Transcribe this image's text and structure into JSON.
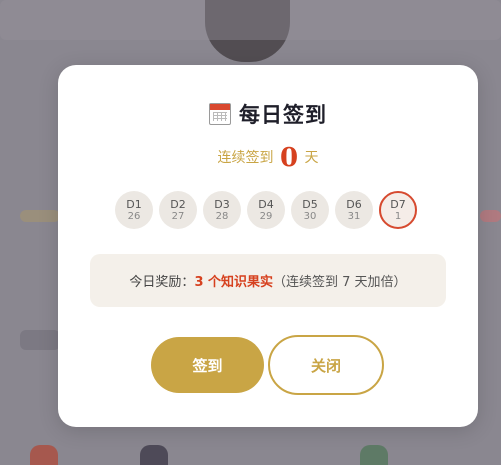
{
  "modal": {
    "title": "每日签到",
    "streak_prefix": "连续签到",
    "streak_count": "0",
    "streak_suffix": "天",
    "days": [
      {
        "label": "D1",
        "date": "26"
      },
      {
        "label": "D2",
        "date": "27"
      },
      {
        "label": "D3",
        "date": "28"
      },
      {
        "label": "D4",
        "date": "29"
      },
      {
        "label": "D5",
        "date": "30"
      },
      {
        "label": "D6",
        "date": "31"
      },
      {
        "label": "D7",
        "date": "1"
      }
    ],
    "reward_prefix": "今日奖励：",
    "reward_amount": "3 个知识果实",
    "reward_note": "（连续签到 7 天加倍）",
    "sign_button": "签到",
    "close_button": "关闭"
  },
  "colors": {
    "accent_gold": "#c9a545",
    "highlight_red": "#d6411f",
    "backdrop": "#8a8790"
  },
  "icons": {
    "title_icon": "calendar-icon"
  }
}
